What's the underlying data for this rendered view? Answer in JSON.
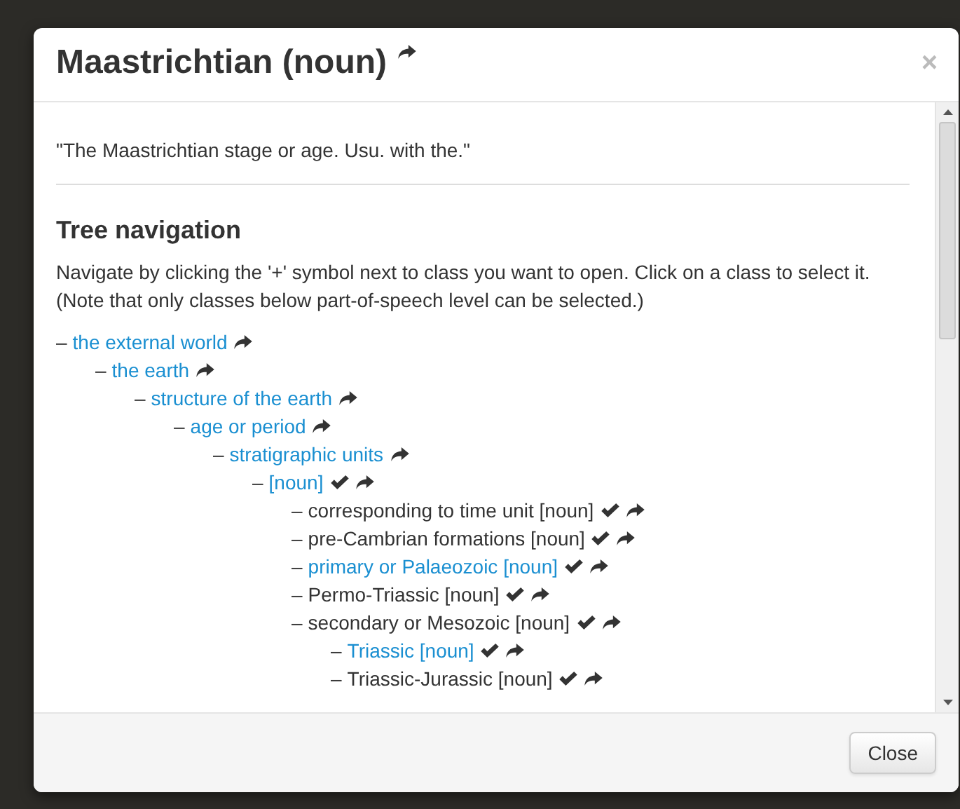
{
  "dialog": {
    "title": "Maastrichtian (noun)",
    "close_symbol": "×",
    "definition": "\"The Maastrichtian stage or age. Usu. with the.\"",
    "section_title": "Tree navigation",
    "instructions": "Navigate by clicking the '+' symbol next to class you want to open. Click on a class to select it. (Note that only classes below part-of-speech level can be selected.)",
    "tree": [
      {
        "bullet": "–",
        "label": "the external world",
        "linked": true,
        "selectable": false,
        "children": [
          {
            "bullet": "–",
            "label": "the earth",
            "linked": true,
            "selectable": false,
            "children": [
              {
                "bullet": "–",
                "label": "structure of the earth",
                "linked": true,
                "selectable": false,
                "children": [
                  {
                    "bullet": "–",
                    "label": "age or period",
                    "linked": true,
                    "selectable": false,
                    "children": [
                      {
                        "bullet": "–",
                        "label": "stratigraphic units",
                        "linked": true,
                        "selectable": false,
                        "children": [
                          {
                            "bullet": "–",
                            "label": "[noun]",
                            "linked": true,
                            "selectable": true,
                            "children": [
                              {
                                "bullet": "–",
                                "label": "corresponding to time unit [noun]",
                                "linked": false,
                                "selectable": true
                              },
                              {
                                "bullet": "–",
                                "label": "pre-Cambrian formations [noun]",
                                "linked": false,
                                "selectable": true
                              },
                              {
                                "bullet": "–",
                                "label": "primary or Palaeozoic [noun]",
                                "linked": true,
                                "selectable": true
                              },
                              {
                                "bullet": "–",
                                "label": "Permo-Triassic [noun]",
                                "linked": false,
                                "selectable": true
                              },
                              {
                                "bullet": "–",
                                "label": "secondary or Mesozoic [noun]",
                                "linked": false,
                                "selectable": true,
                                "children": [
                                  {
                                    "bullet": "–",
                                    "label": "Triassic [noun]",
                                    "linked": true,
                                    "selectable": true
                                  },
                                  {
                                    "bullet": "–",
                                    "label": "Triassic-Jurassic [noun]",
                                    "linked": false,
                                    "selectable": true
                                  }
                                ]
                              }
                            ]
                          }
                        ]
                      }
                    ]
                  }
                ]
              }
            ]
          }
        ]
      }
    ],
    "buttons": [
      "Close"
    ]
  }
}
